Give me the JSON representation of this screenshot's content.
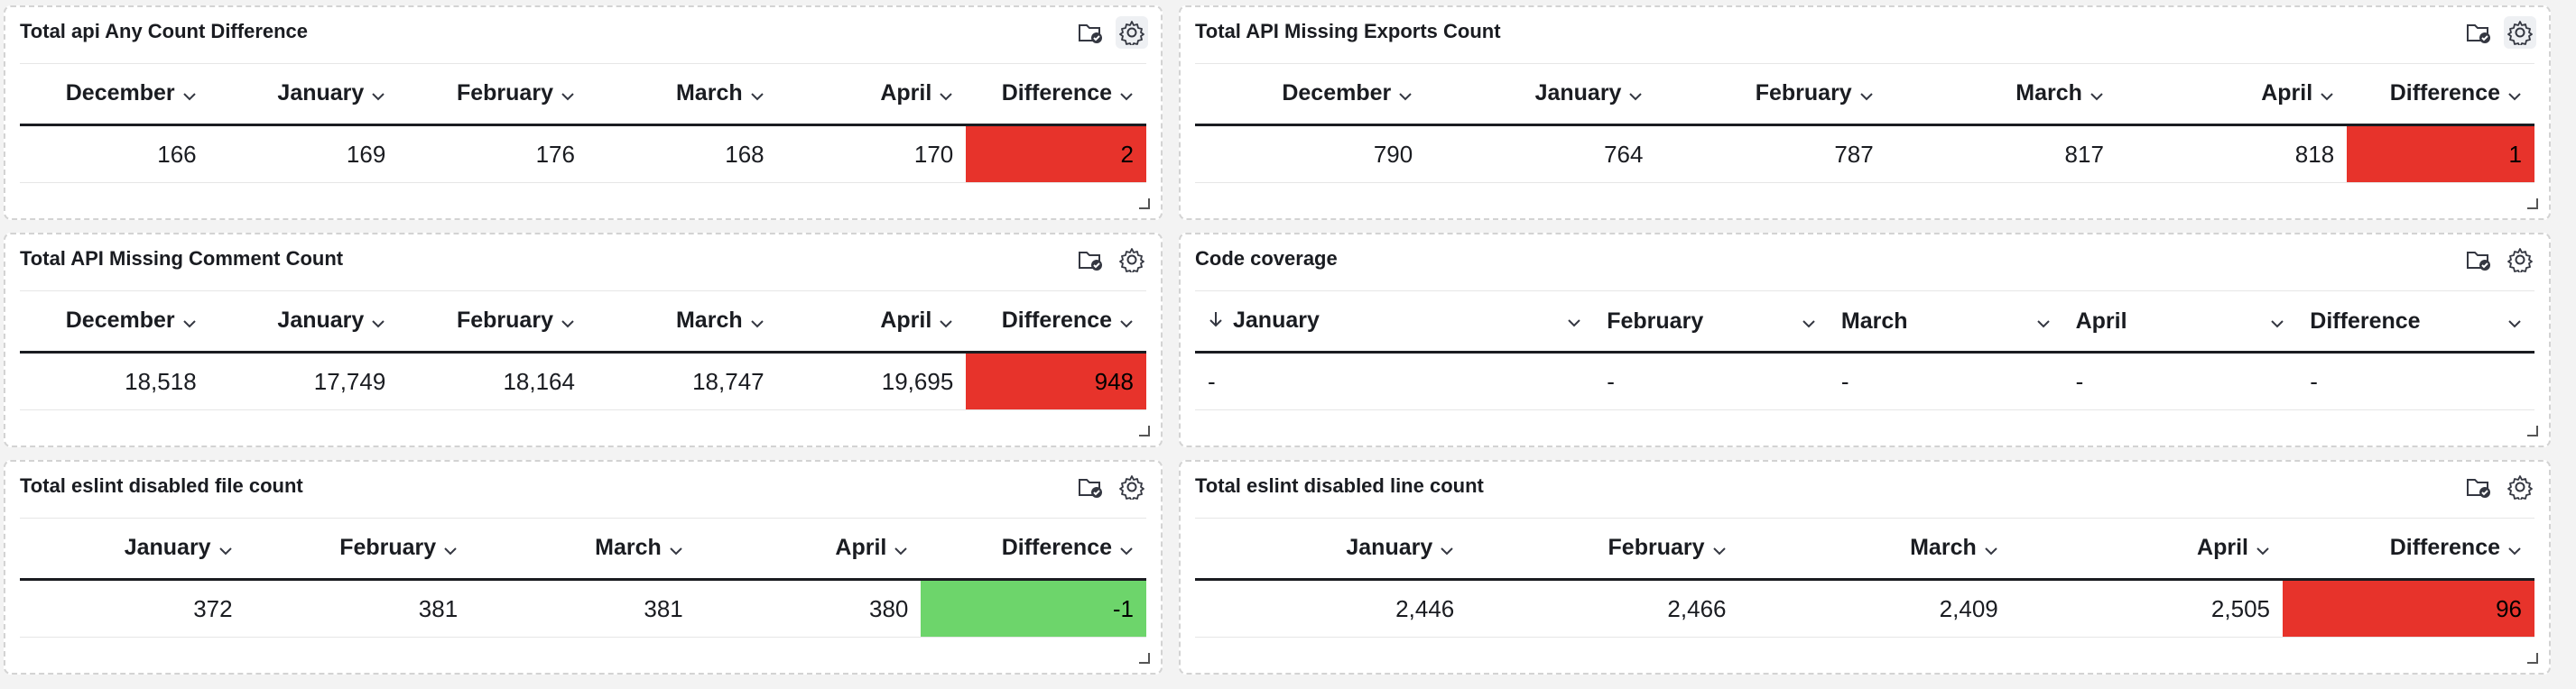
{
  "panels": [
    {
      "title": "Total api Any Count Difference",
      "columns": [
        "December",
        "January",
        "February",
        "March",
        "April",
        "Difference"
      ],
      "rows": [
        [
          "166",
          "169",
          "176",
          "168",
          "170",
          "2"
        ]
      ],
      "diff_status": "red"
    },
    {
      "title": "Total API Missing Exports Count",
      "columns": [
        "December",
        "January",
        "February",
        "March",
        "April",
        "Difference"
      ],
      "rows": [
        [
          "790",
          "764",
          "787",
          "817",
          "818",
          "1"
        ]
      ],
      "diff_status": "red"
    },
    {
      "title": "Total API Missing Comment Count",
      "columns": [
        "December",
        "January",
        "February",
        "March",
        "April",
        "Difference"
      ],
      "rows": [
        [
          "18,518",
          "17,749",
          "18,164",
          "18,747",
          "19,695",
          "948"
        ]
      ],
      "diff_status": "red"
    },
    {
      "title": "Code coverage",
      "columns": [
        "January",
        "February",
        "March",
        "April",
        "Difference"
      ],
      "rows": [
        [
          "-",
          "-",
          "-",
          "-",
          "-"
        ]
      ],
      "diff_status": "none"
    },
    {
      "title": "Total eslint disabled file count",
      "columns": [
        "January",
        "February",
        "March",
        "April",
        "Difference"
      ],
      "rows": [
        [
          "372",
          "381",
          "381",
          "380",
          "-1"
        ]
      ],
      "diff_status": "green"
    },
    {
      "title": "Total eslint disabled line count",
      "columns": [
        "January",
        "February",
        "March",
        "April",
        "Difference"
      ],
      "rows": [
        [
          "2,446",
          "2,466",
          "2,409",
          "2,505",
          "96"
        ]
      ],
      "diff_status": "red"
    }
  ],
  "colors": {
    "diff_red": "#e7332b",
    "diff_green": "#6dd56b"
  },
  "icons": {
    "panel_folder": "folder-check-icon",
    "panel_settings": "gear-icon",
    "column_menu": "chevron-down-icon",
    "sort": "arrow-down-icon"
  }
}
